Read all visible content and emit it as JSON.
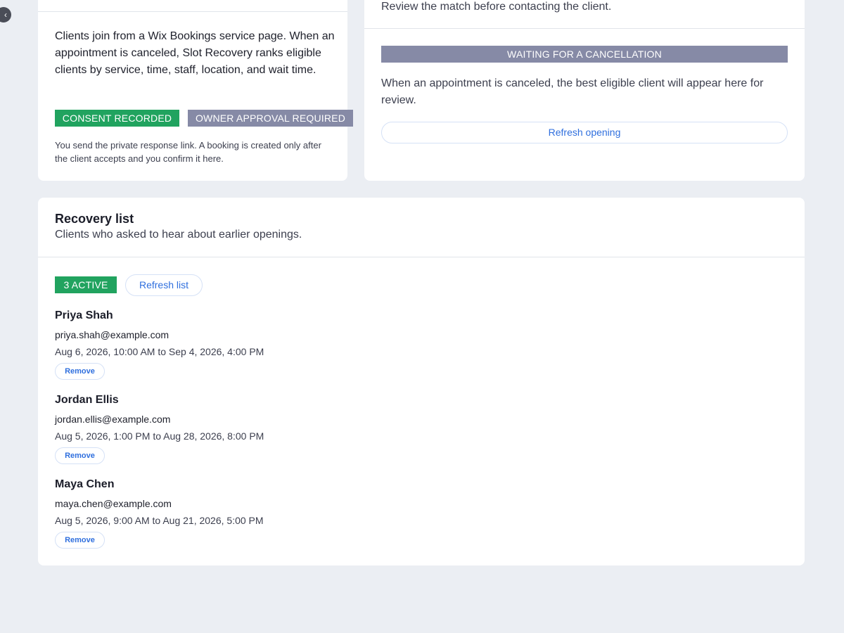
{
  "nav": {
    "collapse_glyph": "‹",
    "collapse_icon": "chevron-left-icon"
  },
  "left_card": {
    "description": "Clients join from a Wix Bookings service page. When an appointment is canceled, Slot Recovery ranks eligible clients by service, time, staff, location, and wait time.",
    "badges": {
      "consent": "CONSENT RECORDED",
      "approval": "OWNER APPROVAL REQUIRED"
    },
    "note": "You send the private response link. A booking is created only after the client accepts and you confirm it here."
  },
  "right_card": {
    "subtitle": "Review the match before contacting the client.",
    "status": "WAITING FOR A CANCELLATION",
    "description": "When an appointment is canceled, the best eligible client will appear here for review.",
    "refresh_label": "Refresh opening"
  },
  "recovery_list": {
    "title": "Recovery list",
    "subtitle": "Clients who asked to hear about earlier openings.",
    "active_badge": "3 ACTIVE",
    "refresh_label": "Refresh list",
    "remove_label": "Remove",
    "clients": [
      {
        "name": "Priya Shah",
        "email": "priya.shah@example.com",
        "range": "Aug 6, 2026, 10:00 AM to Sep 4, 2026, 4:00 PM"
      },
      {
        "name": "Jordan Ellis",
        "email": "jordan.ellis@example.com",
        "range": "Aug 5, 2026, 1:00 PM to Aug 28, 2026, 8:00 PM"
      },
      {
        "name": "Maya Chen",
        "email": "maya.chen@example.com",
        "range": "Aug 5, 2026, 9:00 AM to Aug 21, 2026, 5:00 PM"
      }
    ]
  },
  "colors": {
    "page_bg": "#ebeef3",
    "accent_blue": "#2f6fde",
    "badge_green": "#21a35f",
    "badge_gray": "#868aa6"
  }
}
